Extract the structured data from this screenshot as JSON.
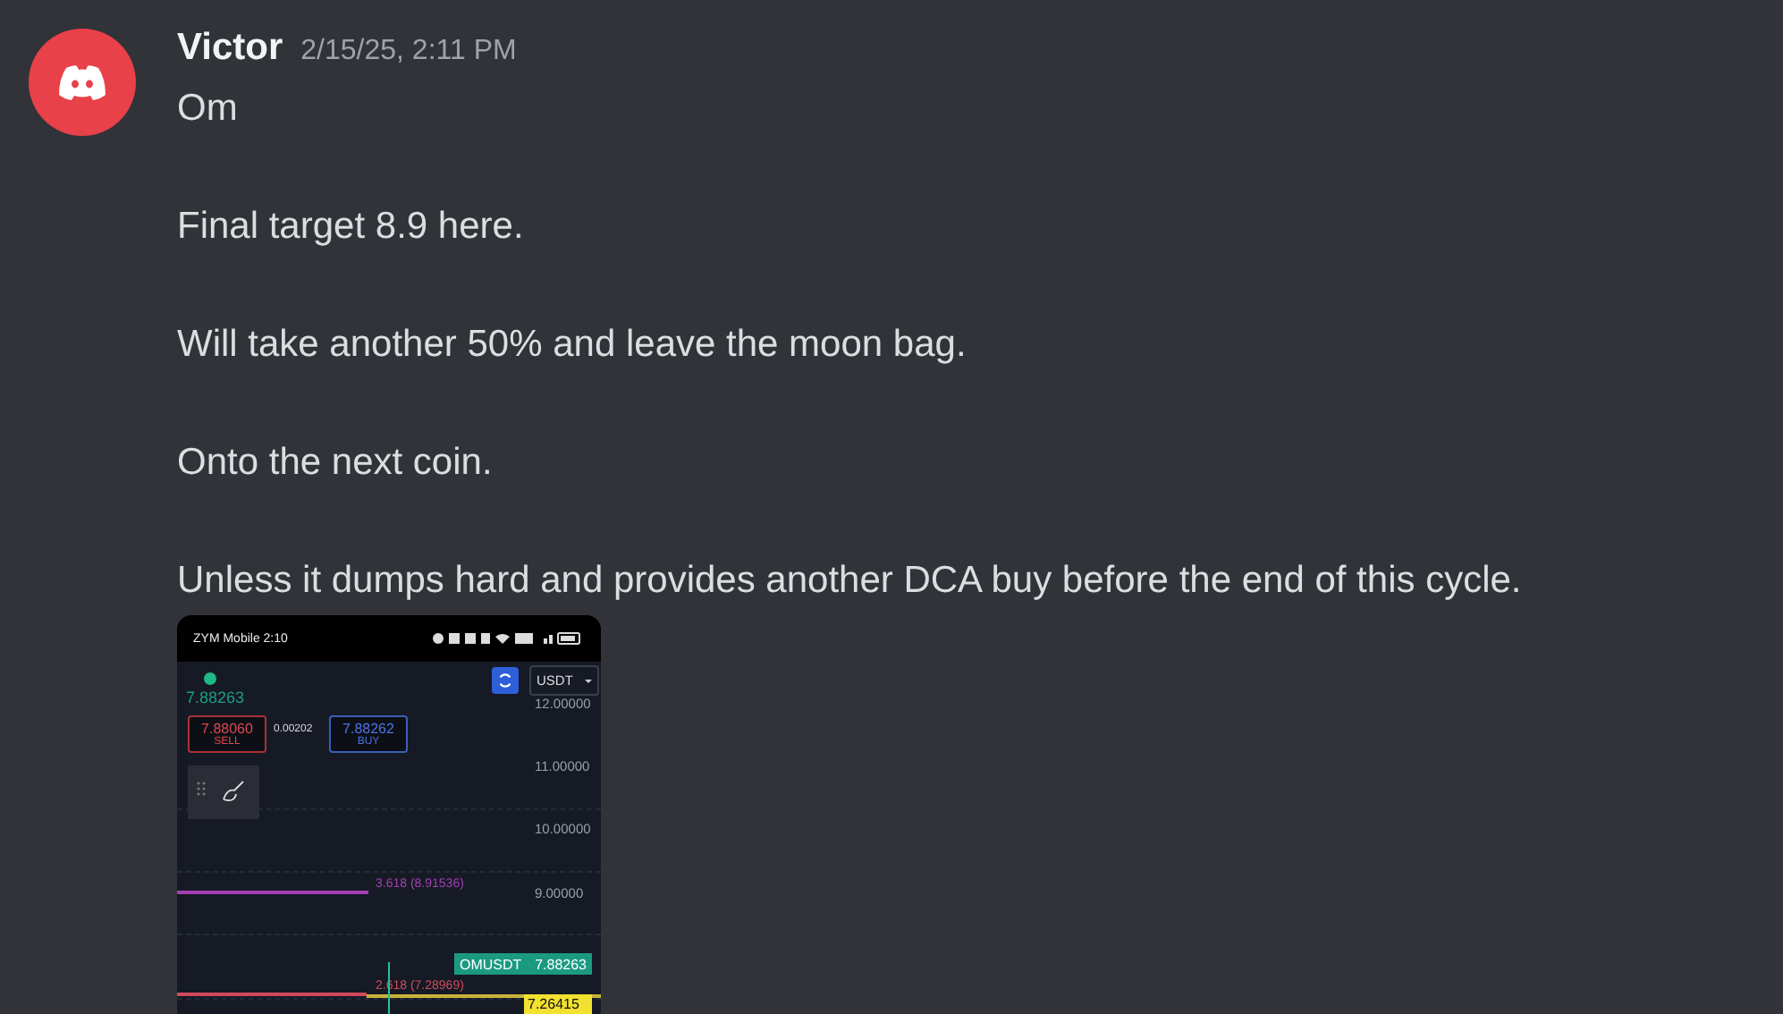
{
  "message": {
    "author": "Victor",
    "timestamp": "2/15/25, 2:11 PM",
    "paragraphs": [
      "Om",
      "Final target 8.9 here.",
      "Will take another 50% and leave the moon bag.",
      "Onto the next coin.",
      "Unless it dumps hard and provides another DCA buy before the end of this cycle."
    ]
  },
  "attachment": {
    "status_text": "ZYM Mobile 2:10",
    "last_price": "7.88263",
    "sell": {
      "price": "7.88060",
      "label": "SELL"
    },
    "spread": "0.00202",
    "buy": {
      "price": "7.88262",
      "label": "BUY"
    },
    "currency": "USDT",
    "axis_labels": [
      "12.00000",
      "11.00000",
      "10.00000",
      "9.00000"
    ],
    "levels": [
      {
        "label": "3.618 (8.91536)",
        "color": "#a43fb4"
      },
      {
        "label": "2.618 (7.28969)",
        "color": "#d04a5c"
      }
    ],
    "symbol_tag": {
      "symbol": "OMUSDT",
      "price": "7.88263"
    },
    "yellow_tag": "7.26415"
  }
}
